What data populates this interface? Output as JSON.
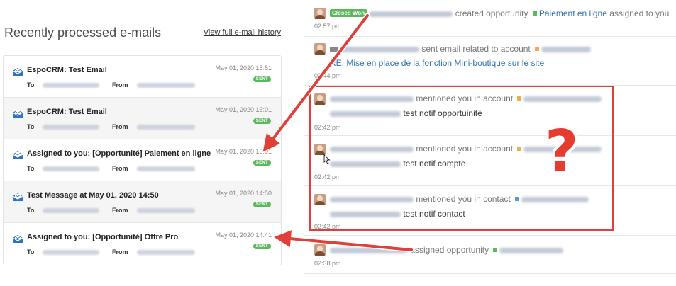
{
  "left": {
    "title": "Recently processed e-mails",
    "history_link": "View full e-mail history",
    "to_label": "To",
    "from_label": "From",
    "emails": [
      {
        "subject": "EspoCRM: Test Email",
        "date": "May 01, 2020 15:51",
        "status": "SENT"
      },
      {
        "subject": "EspoCRM: Test Email",
        "date": "May 01, 2020 15:01",
        "status": "SENT"
      },
      {
        "subject": "Assigned to you: [Opportunité] Paiement en ligne",
        "date": "May 01, 2020 15:01",
        "status": "SENT"
      },
      {
        "subject": "Test Message at May 01, 2020 14:50",
        "date": "May 01, 2020 14:50",
        "status": "SENT"
      },
      {
        "subject": "Assigned to you: [Opportunité] Offre Pro",
        "date": "May 01, 2020 14:41",
        "status": "SENT"
      }
    ]
  },
  "stream": {
    "items": [
      {
        "badge": "Closed Won",
        "action": "created opportunity",
        "link": "Paiement en ligne",
        "suffix": "assigned to you",
        "time": "02:57 pm"
      },
      {
        "action": "sent email related to account",
        "link": "RE: Mise en place de la fonction Mini-boutique sur le site",
        "time": "02:44 pm"
      },
      {
        "action": "mentioned you in account",
        "message": "test notif opportuinité",
        "time": "02:42 pm"
      },
      {
        "action": "mentioned you in account",
        "message": "test notif compte",
        "time": "02:42 pm"
      },
      {
        "action": "mentioned you in contact",
        "message": "test notif contact",
        "time": "02:42 pm"
      },
      {
        "action": "assigned opportunity",
        "time": "02:38 pm"
      }
    ]
  },
  "annotation": {
    "question_mark": "?"
  },
  "colors": {
    "sent_badge": "#5cb85c",
    "link": "#3073b0",
    "annotation_red": "#e0403a",
    "account_square": "#f0ad4e",
    "opportunity_square": "#5cb85c",
    "contact_square": "#5b9bd5"
  }
}
